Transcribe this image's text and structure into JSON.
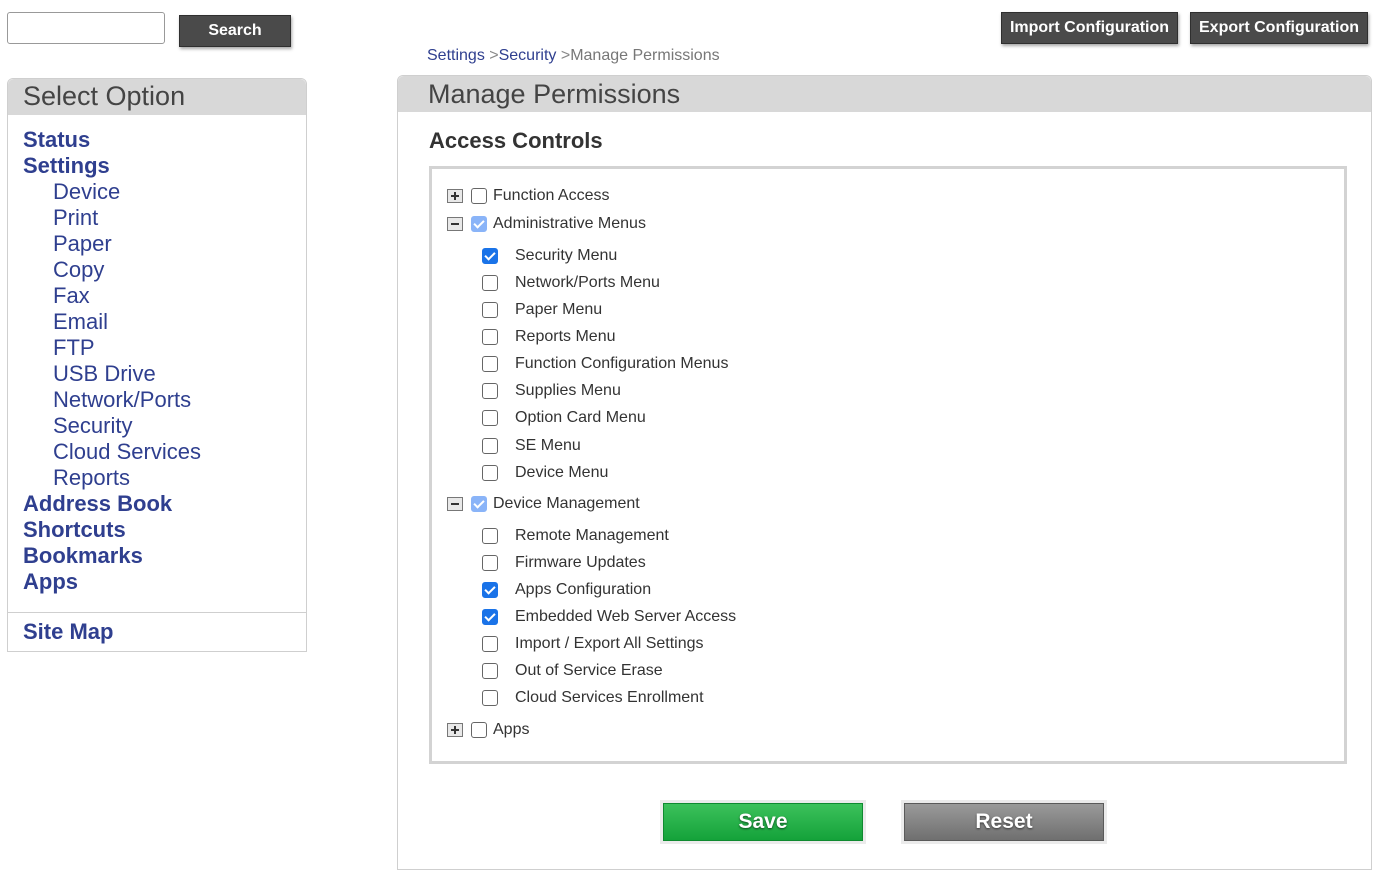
{
  "search": {
    "placeholder": "",
    "value": "",
    "button_label": "Search"
  },
  "toolbar": {
    "import_label": "Import Configuration",
    "export_label": "Export Configuration"
  },
  "breadcrumb": {
    "items": [
      "Settings",
      "Security",
      "Manage Permissions"
    ],
    "separator": ">"
  },
  "sidebar": {
    "title": "Select Option",
    "items": [
      {
        "label": "Status",
        "level": "top"
      },
      {
        "label": "Settings",
        "level": "top"
      },
      {
        "label": "Device",
        "level": "sub"
      },
      {
        "label": "Print",
        "level": "sub"
      },
      {
        "label": "Paper",
        "level": "sub"
      },
      {
        "label": "Copy",
        "level": "sub"
      },
      {
        "label": "Fax",
        "level": "sub"
      },
      {
        "label": "Email",
        "level": "sub"
      },
      {
        "label": "FTP",
        "level": "sub"
      },
      {
        "label": "USB Drive",
        "level": "sub"
      },
      {
        "label": "Network/Ports",
        "level": "sub"
      },
      {
        "label": "Security",
        "level": "sub"
      },
      {
        "label": "Cloud Services",
        "level": "sub"
      },
      {
        "label": "Reports",
        "level": "sub"
      },
      {
        "label": "Address Book",
        "level": "top"
      },
      {
        "label": "Shortcuts",
        "level": "top"
      },
      {
        "label": "Bookmarks",
        "level": "top"
      },
      {
        "label": "Apps",
        "level": "top"
      }
    ],
    "sitemap_label": "Site Map"
  },
  "main": {
    "title": "Manage Permissions",
    "section_title": "Access Controls",
    "groups": [
      {
        "label": "Function Access",
        "expanded": false,
        "checked": false,
        "children": []
      },
      {
        "label": "Administrative Menus",
        "expanded": true,
        "checked": true,
        "children": [
          {
            "label": "Security Menu",
            "checked": true
          },
          {
            "label": "Network/Ports Menu",
            "checked": false
          },
          {
            "label": "Paper Menu",
            "checked": false
          },
          {
            "label": "Reports Menu",
            "checked": false
          },
          {
            "label": "Function Configuration Menus",
            "checked": false
          },
          {
            "label": "Supplies Menu",
            "checked": false
          },
          {
            "label": "Option Card Menu",
            "checked": false
          },
          {
            "label": "SE Menu",
            "checked": false
          },
          {
            "label": "Device Menu",
            "checked": false
          }
        ]
      },
      {
        "label": "Device Management",
        "expanded": true,
        "checked": true,
        "children": [
          {
            "label": "Remote Management",
            "checked": false
          },
          {
            "label": "Firmware Updates",
            "checked": false
          },
          {
            "label": "Apps Configuration",
            "checked": true
          },
          {
            "label": "Embedded Web Server Access",
            "checked": true
          },
          {
            "label": "Import / Export All Settings",
            "checked": false
          },
          {
            "label": "Out of Service Erase",
            "checked": false
          },
          {
            "label": "Cloud Services Enrollment",
            "checked": false
          }
        ]
      },
      {
        "label": "Apps",
        "expanded": false,
        "checked": false,
        "children": []
      }
    ],
    "save_label": "Save",
    "reset_label": "Reset"
  },
  "colors": {
    "link": "#2f3f8f",
    "header_bg": "#d8d8d8",
    "dark_button": "#4a4a4a",
    "save_green": "#14a23a",
    "reset_gray": "#6f6f6f",
    "checkbox_blue": "#1a73e8"
  }
}
